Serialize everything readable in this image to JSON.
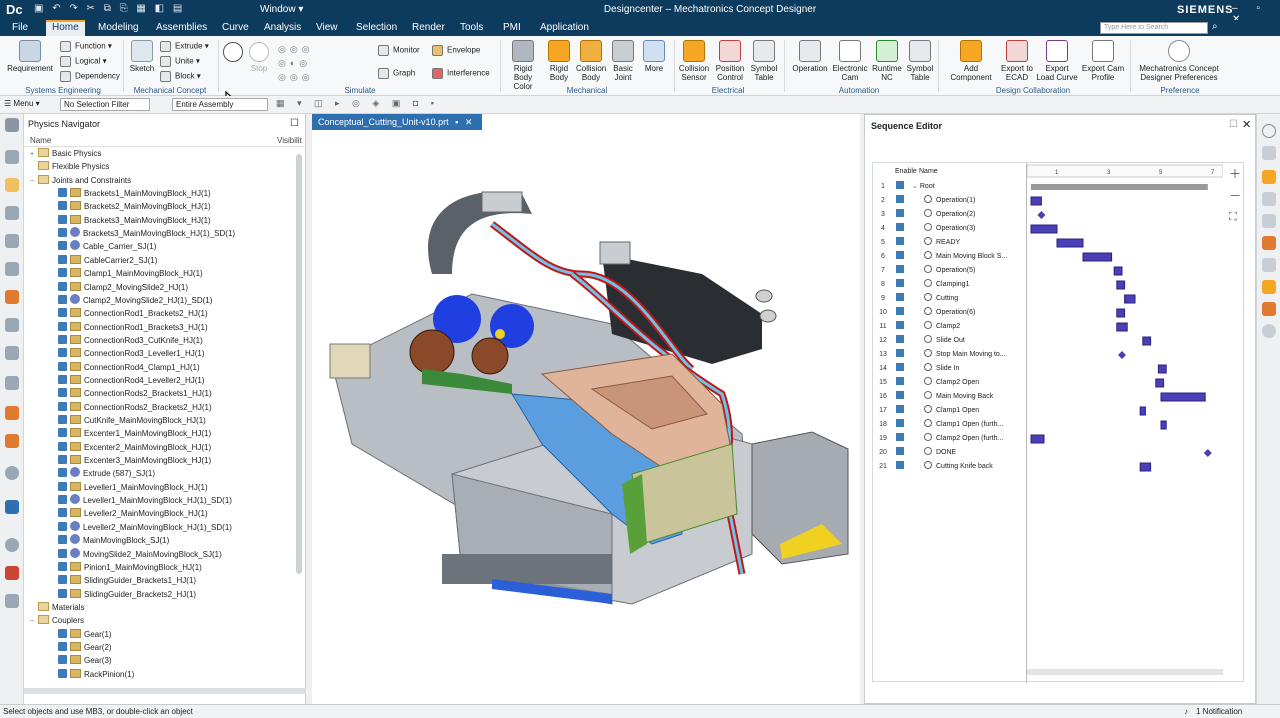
{
  "titlebar": {
    "logo": "Dc",
    "window_menu": "Window ▾",
    "title": "Designcenter – Mechatronics Concept Designer",
    "brand": "SIEMENS",
    "controls": "–  ▫  ✕"
  },
  "menu": {
    "tabs": [
      "File",
      "Home",
      "Modeling",
      "Assemblies",
      "Curve",
      "Analysis",
      "View",
      "Selection",
      "Render",
      "Tools",
      "PMI",
      "Application"
    ],
    "active": "Home",
    "search_placeholder": "Type Here to Search"
  },
  "ribbon": {
    "systems_engineering": {
      "requirement": "Requirement",
      "function": "Function",
      "logical": "Logical",
      "dependency": "Dependency",
      "group": "Systems Engineering"
    },
    "mech_concept": {
      "sketch": "Sketch",
      "extrude": "Extrude",
      "unite": "Unite",
      "block": "Block",
      "group": "Mechanical Concept"
    },
    "simulate": {
      "play": "Play",
      "stop": "Stop",
      "monitor": "Monitor",
      "graph": "Graph",
      "envelope": "Envelope",
      "interference": "Interference",
      "group": "Simulate"
    },
    "mechanical": {
      "rigid_body_color": "Rigid Body Color",
      "rigid_body": "Rigid Body",
      "collision_body": "Collision Body",
      "basic_joint": "Basic Joint",
      "more": "More",
      "group": "Mechanical"
    },
    "electrical": {
      "collision_sensor": "Collision Sensor",
      "position_control": "Position Control",
      "symbol_table": "Symbol Table",
      "group": "Electrical"
    },
    "automation": {
      "operation": "Operation",
      "electronic_cam": "Electronic Cam",
      "runtime_nc": "Runtime NC",
      "symbol_table": "Symbol Table",
      "group": "Automation"
    },
    "design_collab": {
      "add_component": "Add Component",
      "export_ecad": "Export to ECAD",
      "export_load_curve": "Export Load Curve",
      "export_cam_profile": "Export Cam Profile",
      "group": "Design Collaboration"
    },
    "preference": {
      "mcd_prefs": "Mechatronics Concept Designer Preferences",
      "group": "Preference"
    }
  },
  "toolbar2": {
    "menu": "Menu ▾",
    "selection_filter": "No Selection Filter",
    "assembly_scope": "Entire Assembly"
  },
  "navigator": {
    "title": "Physics Navigator",
    "col_name": "Name",
    "col_visible": "Visibilit",
    "items": [
      {
        "label": "Basic Physics",
        "level": 0,
        "kind": "folder",
        "toggle": "+"
      },
      {
        "label": "Flexible Physics",
        "level": 0,
        "kind": "folder",
        "toggle": ""
      },
      {
        "label": "Joints and Constraints",
        "level": 0,
        "kind": "folder",
        "toggle": "−"
      },
      {
        "label": "Brackets1_MainMovingBlock_HJ(1)",
        "level": 1,
        "kind": "joint"
      },
      {
        "label": "Brackets2_MainMovingBlock_HJ(1)",
        "level": 1,
        "kind": "joint"
      },
      {
        "label": "Brackets3_MainMovingBlock_HJ(1)",
        "level": 1,
        "kind": "joint"
      },
      {
        "label": "Brackets3_MainMovingBlock_HJ(1)_SD(1)",
        "level": 1,
        "kind": "spring"
      },
      {
        "label": "Cable_Carrier_SJ(1)",
        "level": 1,
        "kind": "spring"
      },
      {
        "label": "CableCarrier2_SJ(1)",
        "level": 1,
        "kind": "joint"
      },
      {
        "label": "Clamp1_MainMovingBlock_HJ(1)",
        "level": 1,
        "kind": "joint"
      },
      {
        "label": "Clamp2_MovingSlide2_HJ(1)",
        "level": 1,
        "kind": "joint"
      },
      {
        "label": "Clamp2_MovingSlide2_HJ(1)_SD(1)",
        "level": 1,
        "kind": "spring"
      },
      {
        "label": "ConnectionRod1_Brackets2_HJ(1)",
        "level": 1,
        "kind": "joint"
      },
      {
        "label": "ConnectionRod1_Brackets3_HJ(1)",
        "level": 1,
        "kind": "joint"
      },
      {
        "label": "ConnectionRod3_CutKnife_HJ(1)",
        "level": 1,
        "kind": "joint"
      },
      {
        "label": "ConnectionRod3_Leveller1_HJ(1)",
        "level": 1,
        "kind": "joint"
      },
      {
        "label": "ConnectionRod4_Clamp1_HJ(1)",
        "level": 1,
        "kind": "joint"
      },
      {
        "label": "ConnectionRod4_Leveller2_HJ(1)",
        "level": 1,
        "kind": "joint"
      },
      {
        "label": "ConnectionRods2_Brackets1_HJ(1)",
        "level": 1,
        "kind": "joint"
      },
      {
        "label": "ConnectionRods2_Brackets2_HJ(1)",
        "level": 1,
        "kind": "joint"
      },
      {
        "label": "CutKnife_MainMovingBlock_HJ(1)",
        "level": 1,
        "kind": "joint"
      },
      {
        "label": "Excenter1_MainMovingBlock_HJ(1)",
        "level": 1,
        "kind": "joint"
      },
      {
        "label": "Excenter2_MainMovingBlock_HJ(1)",
        "level": 1,
        "kind": "joint"
      },
      {
        "label": "Excenter3_MainMovingBlock_HJ(1)",
        "level": 1,
        "kind": "joint"
      },
      {
        "label": "Extrude (587)_SJ(1)",
        "level": 1,
        "kind": "spring"
      },
      {
        "label": "Leveller1_MainMovingBlock_HJ(1)",
        "level": 1,
        "kind": "joint"
      },
      {
        "label": "Leveller1_MainMovingBlock_HJ(1)_SD(1)",
        "level": 1,
        "kind": "spring"
      },
      {
        "label": "Leveller2_MainMovingBlock_HJ(1)",
        "level": 1,
        "kind": "joint"
      },
      {
        "label": "Leveller2_MainMovingBlock_HJ(1)_SD(1)",
        "level": 1,
        "kind": "spring"
      },
      {
        "label": "MainMovingBlock_SJ(1)",
        "level": 1,
        "kind": "spring"
      },
      {
        "label": "MovingSlide2_MainMovingBlock_SJ(1)",
        "level": 1,
        "kind": "spring"
      },
      {
        "label": "Pinion1_MainMovingBlock_HJ(1)",
        "level": 1,
        "kind": "joint"
      },
      {
        "label": "SlidingGuider_Brackets1_HJ(1)",
        "level": 1,
        "kind": "joint"
      },
      {
        "label": "SlidingGuider_Brackets2_HJ(1)",
        "level": 1,
        "kind": "joint"
      },
      {
        "label": "Materials",
        "level": 0,
        "kind": "folder",
        "toggle": ""
      },
      {
        "label": "Couplers",
        "level": 0,
        "kind": "folder",
        "toggle": "−"
      },
      {
        "label": "Gear(1)",
        "level": 1,
        "kind": "joint"
      },
      {
        "label": "Gear(2)",
        "level": 1,
        "kind": "joint"
      },
      {
        "label": "Gear(3)",
        "level": 1,
        "kind": "joint"
      },
      {
        "label": "RackPinion(1)",
        "level": 1,
        "kind": "joint"
      }
    ]
  },
  "viewport": {
    "tab": "Conceptual_Cutting_Unit-v10.prt"
  },
  "sequence": {
    "title": "Sequence Editor",
    "col_enable": "Enable",
    "col_name": "Name",
    "ticks": [
      "1",
      "3",
      "5",
      "7"
    ],
    "rows": [
      {
        "n": "1",
        "label": "Root",
        "kind": "root"
      },
      {
        "n": "2",
        "label": "Operation(1)"
      },
      {
        "n": "3",
        "label": "Operation(2)"
      },
      {
        "n": "4",
        "label": "Operation(3)"
      },
      {
        "n": "5",
        "label": "READY"
      },
      {
        "n": "6",
        "label": "Main Moving Block S..."
      },
      {
        "n": "7",
        "label": "Operation(5)"
      },
      {
        "n": "8",
        "label": "Clamping1"
      },
      {
        "n": "9",
        "label": "Cutting"
      },
      {
        "n": "10",
        "label": "Operation(6)"
      },
      {
        "n": "11",
        "label": "Clamp2"
      },
      {
        "n": "12",
        "label": "Slide Out"
      },
      {
        "n": "13",
        "label": "Stop Main Moving to..."
      },
      {
        "n": "14",
        "label": "Slide In"
      },
      {
        "n": "15",
        "label": "Clamp2 Open"
      },
      {
        "n": "16",
        "label": "Main Moving Back"
      },
      {
        "n": "17",
        "label": "Clamp1 Open"
      },
      {
        "n": "18",
        "label": "Clamp1 Open (furth..."
      },
      {
        "n": "19",
        "label": "Clamp2 Open (furth..."
      },
      {
        "n": "20",
        "label": "DONE"
      },
      {
        "n": "21",
        "label": "Cutting Knife back"
      }
    ],
    "gantt": [
      {
        "row": 1,
        "start": 0.0,
        "end": 6.8,
        "type": "root"
      },
      {
        "row": 2,
        "start": 0.0,
        "end": 0.4,
        "type": "bar"
      },
      {
        "row": 3,
        "start": 0.4,
        "end": 0.4,
        "type": "mile"
      },
      {
        "row": 4,
        "start": 0.0,
        "end": 1.0,
        "type": "bar"
      },
      {
        "row": 5,
        "start": 1.0,
        "end": 2.0,
        "type": "bar"
      },
      {
        "row": 6,
        "start": 2.0,
        "end": 3.1,
        "type": "bar"
      },
      {
        "row": 7,
        "start": 3.2,
        "end": 3.5,
        "type": "bar"
      },
      {
        "row": 8,
        "start": 3.3,
        "end": 3.6,
        "type": "bar"
      },
      {
        "row": 9,
        "start": 3.6,
        "end": 4.0,
        "type": "bar"
      },
      {
        "row": 10,
        "start": 3.3,
        "end": 3.6,
        "type": "bar"
      },
      {
        "row": 11,
        "start": 3.3,
        "end": 3.7,
        "type": "bar"
      },
      {
        "row": 12,
        "start": 4.3,
        "end": 4.6,
        "type": "bar"
      },
      {
        "row": 13,
        "start": 3.5,
        "end": 3.5,
        "type": "mile"
      },
      {
        "row": 14,
        "start": 4.9,
        "end": 5.2,
        "type": "bar"
      },
      {
        "row": 15,
        "start": 4.8,
        "end": 5.1,
        "type": "bar"
      },
      {
        "row": 16,
        "start": 5.0,
        "end": 6.7,
        "type": "bar"
      },
      {
        "row": 17,
        "start": 4.2,
        "end": 4.4,
        "type": "bar"
      },
      {
        "row": 18,
        "start": 5.0,
        "end": 5.2,
        "type": "bar"
      },
      {
        "row": 19,
        "start": 0.0,
        "end": 0.5,
        "type": "bar"
      },
      {
        "row": 20,
        "start": 6.8,
        "end": 6.8,
        "type": "mile"
      },
      {
        "row": 21,
        "start": 4.2,
        "end": 4.6,
        "type": "bar"
      }
    ]
  },
  "status": {
    "hint": "Select objects and use MB3, or double-click an object",
    "notifications": "1 Notification"
  },
  "colors": {
    "titlebar": "#0d3b5e",
    "accent": "#f6a623",
    "tab_blue": "#2e6fb0",
    "gantt_bar": "#4a3fb5"
  }
}
